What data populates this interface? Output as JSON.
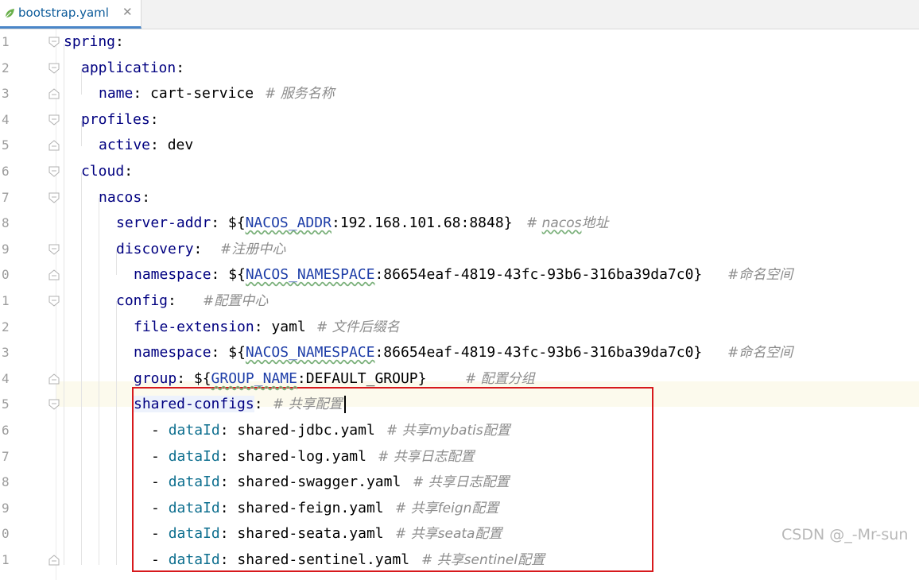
{
  "tab": {
    "filename": "bootstrap.yaml",
    "close_glyph": "✕",
    "icon": "spring-leaf-icon"
  },
  "gutter": {
    "line_numbers": [
      "1",
      "2",
      "3",
      "4",
      "5",
      "6",
      "7",
      "8",
      "9",
      "0",
      "1",
      "2",
      "3",
      "4",
      "5",
      "6",
      "7",
      "8",
      "9",
      "0",
      "1"
    ]
  },
  "lines": [
    {
      "num": "1",
      "key": "spring",
      "sep": ":",
      "value": "",
      "comment": ""
    },
    {
      "num": "2",
      "key": "application",
      "sep": ":",
      "value": "",
      "comment": ""
    },
    {
      "num": "3",
      "key": "name",
      "sep": ":",
      "value": " cart-service",
      "comment": "# 服务名称"
    },
    {
      "num": "4",
      "key": "profiles",
      "sep": ":",
      "value": "",
      "comment": ""
    },
    {
      "num": "5",
      "key": "active",
      "sep": ":",
      "value": " dev",
      "comment": ""
    },
    {
      "num": "6",
      "key": "cloud",
      "sep": ":",
      "value": "",
      "comment": ""
    },
    {
      "num": "7",
      "key": "nacos",
      "sep": ":",
      "value": "",
      "comment": ""
    },
    {
      "num": "8",
      "key": "server-addr",
      "sep": ":",
      "value_prefix": " ${",
      "env": "NACOS_ADDR",
      "value_suffix": ":192.168.101.68:8848}",
      "comment_prefix": "# ",
      "comment_wavy": "nacos",
      "comment_rest": "地址"
    },
    {
      "num": "9",
      "key": "discovery",
      "sep": ":",
      "value": "",
      "comment": "#注册中心"
    },
    {
      "num": "0",
      "key": "namespace",
      "sep": ":",
      "value_prefix": " ${",
      "env": "NACOS_NAMESPACE",
      "value_suffix": ":86654eaf-4819-43fc-93b6-316ba39da7c0}",
      "comment": "#命名空间"
    },
    {
      "num": "1",
      "key": "config",
      "sep": ":",
      "value": "",
      "comment": "#配置中心"
    },
    {
      "num": "2",
      "key": "file-extension",
      "sep": ":",
      "value": " yaml",
      "comment": "# 文件后缀名"
    },
    {
      "num": "3",
      "key": "namespace",
      "sep": ":",
      "value_prefix": " ${",
      "env": "NACOS_NAMESPACE",
      "value_suffix": ":86654eaf-4819-43fc-93b6-316ba39da7c0}",
      "comment": "#命名空间"
    },
    {
      "num": "4",
      "key": "group",
      "sep": ":",
      "value_prefix": " ${",
      "env": "GROUP_NAME",
      "value_suffix": ":DEFAULT_GROUP}",
      "comment": "# 配置分组"
    },
    {
      "num": "5",
      "key": "shared-configs",
      "sep": ":",
      "value": "",
      "comment": "# 共享配置"
    },
    {
      "num": "6",
      "dash": "- ",
      "key": "dataId",
      "sep": ":",
      "value": " shared-jdbc.yaml",
      "comment": "# 共享mybatis配置"
    },
    {
      "num": "7",
      "dash": "- ",
      "key": "dataId",
      "sep": ":",
      "value": " shared-log.yaml",
      "comment": "# 共享日志配置"
    },
    {
      "num": "8",
      "dash": "- ",
      "key": "dataId",
      "sep": ":",
      "value": " shared-swagger.yaml",
      "comment": "# 共享日志配置"
    },
    {
      "num": "9",
      "dash": "- ",
      "key": "dataId",
      "sep": ":",
      "value": " shared-feign.yaml",
      "comment": "# 共享feign配置"
    },
    {
      "num": "0",
      "dash": "- ",
      "key": "dataId",
      "sep": ":",
      "value": " shared-seata.yaml",
      "comment": "# 共享seata配置"
    },
    {
      "num": "1",
      "dash": "- ",
      "key": "dataId",
      "sep": ":",
      "value": " shared-sentinel.yaml",
      "comment": "# 共享sentinel配置"
    }
  ],
  "watermark": "CSDN @_-Mr-sun",
  "colors": {
    "key": "#000080",
    "list_key": "#0e6f8f",
    "comment": "#8c8c8c",
    "env": "#1e3ea8",
    "current_line": "#fcfaed",
    "highlight_box": "#d7191c",
    "tab_underline": "#4a86c8"
  }
}
